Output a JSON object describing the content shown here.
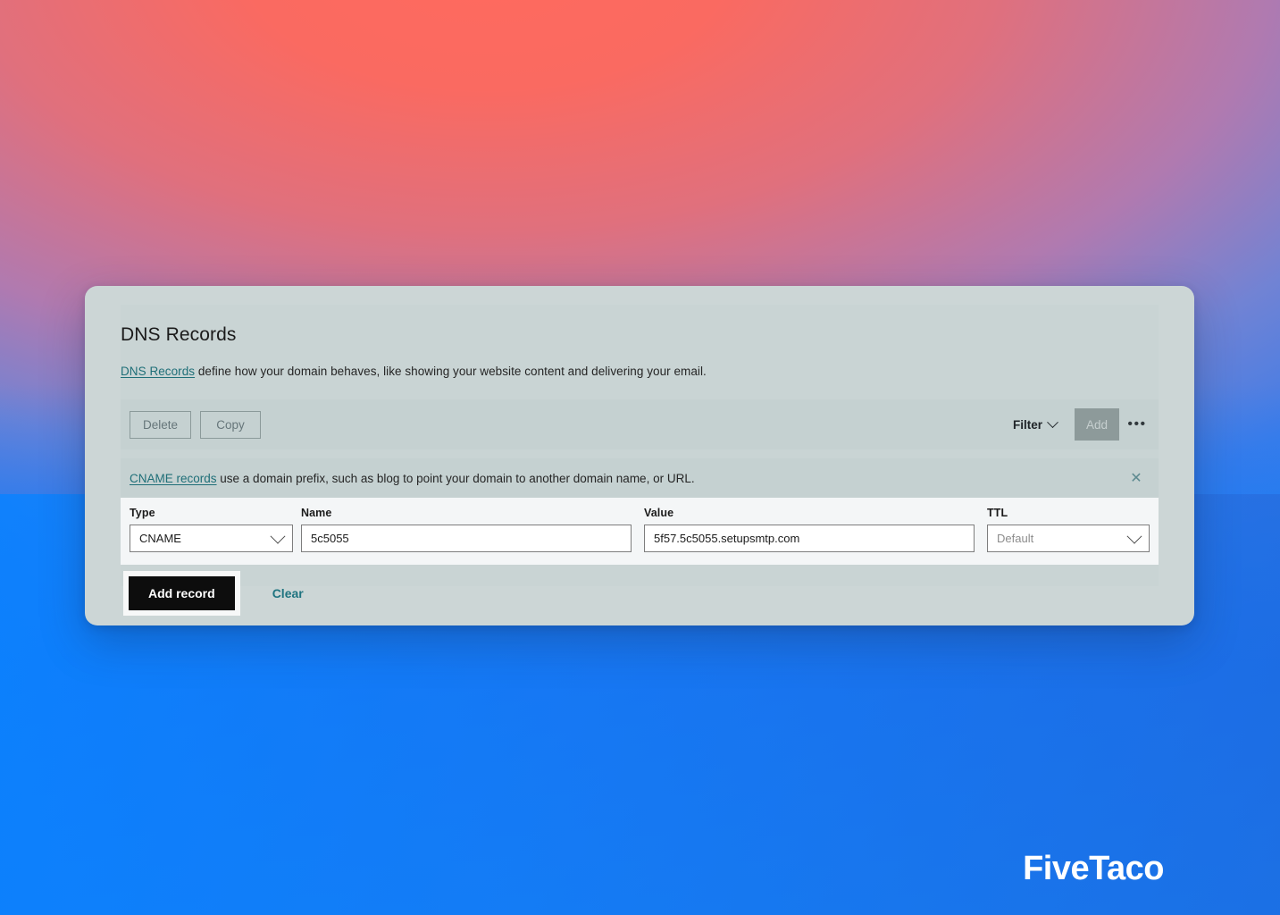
{
  "panel": {
    "title": "DNS Records",
    "description_link": "DNS Records",
    "description_rest": " define how your domain behaves, like showing your website content and delivering your email."
  },
  "toolbar": {
    "delete_label": "Delete",
    "copy_label": "Copy",
    "filter_label": "Filter",
    "add_label": "Add",
    "more_label": "•••"
  },
  "notice": {
    "link_text": "CNAME records",
    "rest_text": " use a domain prefix, such as blog to point your domain to another domain name, or URL.",
    "close_label": "✕"
  },
  "form": {
    "type": {
      "label": "Type",
      "value": "CNAME"
    },
    "name": {
      "label": "Name",
      "value": "5c5055"
    },
    "value": {
      "label": "Value",
      "value": "5f57.5c5055.setupsmtp.com"
    },
    "ttl": {
      "label": "TTL",
      "value": "Default"
    }
  },
  "actions": {
    "add_record_label": "Add record",
    "clear_label": "Clear"
  },
  "branding": {
    "logo_text": "FiveTaco"
  },
  "colors": {
    "accent_teal": "#1f6f78",
    "link_clear": "#1f7480",
    "card_bg": "#ccd6d6",
    "panel_bg": "#c9d4d4",
    "row_bg": "#c5d1d1",
    "fields_bg": "#f4f6f7",
    "primary_button": "#0d0d0d",
    "add_button": "#8d9a9a",
    "gradient_top": "#ff6a5e",
    "gradient_bottom": "#117ef8"
  }
}
